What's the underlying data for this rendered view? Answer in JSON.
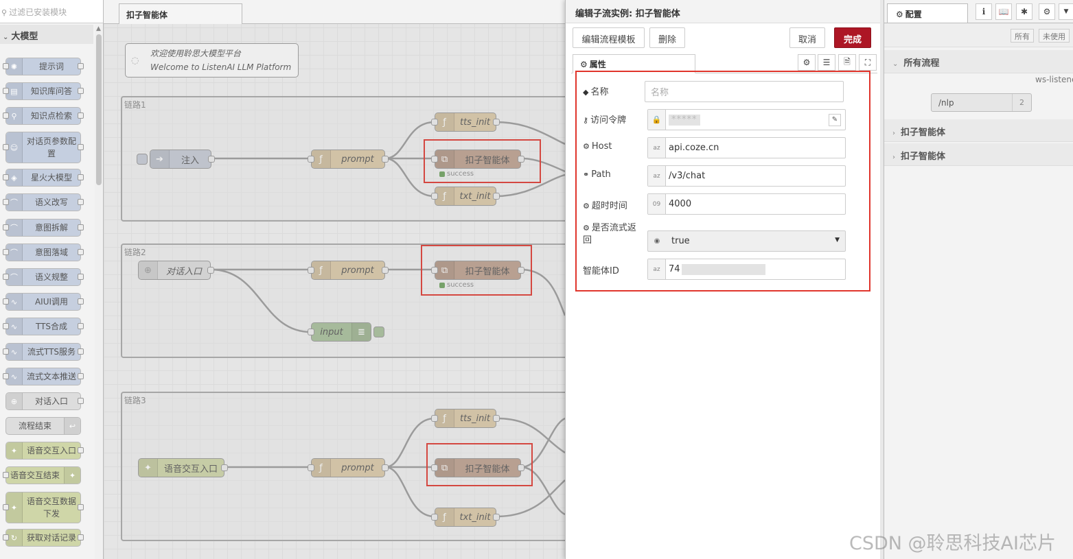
{
  "palette": {
    "search_placeholder": "过滤已安装模块",
    "category": "大模型",
    "items": [
      {
        "label": "提示词",
        "color": "#c5cfe0",
        "icon": "lightbulb-icon"
      },
      {
        "label": "知识库问答",
        "color": "#c5cfe0",
        "icon": "book-icon"
      },
      {
        "label": "知识点检索",
        "color": "#c5cfe0",
        "icon": "search-icon"
      },
      {
        "label": "对话页参数配置",
        "color": "#c5cfe0",
        "icon": "user-icon"
      },
      {
        "label": "星火大模型",
        "color": "#c5cfe0",
        "icon": "spark-icon"
      },
      {
        "label": "语义改写",
        "color": "#c6cfdf",
        "icon": "arch-icon"
      },
      {
        "label": "意图拆解",
        "color": "#c6cfdf",
        "icon": "arch-icon"
      },
      {
        "label": "意图落域",
        "color": "#c6cfdf",
        "icon": "arch-icon"
      },
      {
        "label": "语义规整",
        "color": "#c6cfdf",
        "icon": "arch-icon"
      },
      {
        "label": "AIUI调用",
        "color": "#c6cfdf",
        "icon": "wave-icon"
      },
      {
        "label": "TTS合成",
        "color": "#c6cfdf",
        "icon": "wave-icon"
      },
      {
        "label": "流式TTS服务",
        "color": "#c6cfdf",
        "icon": "wave-icon"
      },
      {
        "label": "流式文本推送",
        "color": "#c6cfdf",
        "icon": "wave-icon"
      },
      {
        "label": "对话入口",
        "color": "#dddddd",
        "icon": "enter-icon"
      },
      {
        "label": "流程结束",
        "color": "#dddddd",
        "icon": "exit-icon"
      },
      {
        "label": "语音交互入口",
        "color": "#cfd6a8",
        "icon": "puzzle-icon"
      },
      {
        "label": "语音交互结束",
        "color": "#cfd6a8",
        "icon": "puzzle-icon"
      },
      {
        "label": "语音交互数据下发",
        "color": "#cfd6a8",
        "icon": "puzzle-icon"
      },
      {
        "label": "获取对话记录",
        "color": "#cfd6a8",
        "icon": "history-icon"
      }
    ]
  },
  "workspace": {
    "tab_label": "扣子智能体",
    "comment": {
      "line1": "欢迎使用聆思大模型平台",
      "line2": "Welcome to ListenAI LLM Platform"
    },
    "groups": [
      {
        "label": "链路1"
      },
      {
        "label": "链路2"
      },
      {
        "label": "链路3"
      }
    ],
    "nodes": {
      "inject": "注入",
      "prompt": "prompt",
      "tts_init": "tts_init",
      "txt_init": "txt_init",
      "coze": "扣子智能体",
      "dialog_entry": "对话入口",
      "input": "input",
      "voice_entry": "语音交互入口",
      "status_success": "success"
    }
  },
  "tray": {
    "title": "编辑子流实例:  扣子智能体",
    "edit_template_label": "编辑流程模板",
    "delete_label": "删除",
    "cancel_label": "取消",
    "done_label": "完成",
    "tab_properties": "属性",
    "fields": {
      "name": {
        "label": "名称",
        "placeholder": "名称"
      },
      "token": {
        "label": "访问令牌",
        "value": "*****"
      },
      "host": {
        "label": "Host",
        "value": "api.coze.cn",
        "type_tag": "az"
      },
      "path": {
        "label": "Path",
        "value": "/v3/chat",
        "type_tag": "az"
      },
      "timeout": {
        "label": "超时时间",
        "value": "4000",
        "type_tag": "09"
      },
      "stream": {
        "label_line1": "是否流式返",
        "label_line2": "回",
        "value": "true"
      },
      "agent_id": {
        "label": "智能体ID",
        "value": "74",
        "type_tag": "az"
      }
    }
  },
  "sidebar": {
    "tab_label": "配置",
    "filter_all": "所有",
    "filter_unused": "未使用",
    "all_flows": "所有流程",
    "ws_item": "ws-listene",
    "nlp_label": "/nlp",
    "nlp_count": "2",
    "coze_1": "扣子智能体",
    "coze_2": "扣子智能体"
  },
  "watermark": "CSDN @聆思科技AI芯片",
  "colors": {
    "accent": "#ad1625",
    "highlight": "#e0342b",
    "function_node": "#dccaa8",
    "subflow_node": "#bda08e"
  }
}
